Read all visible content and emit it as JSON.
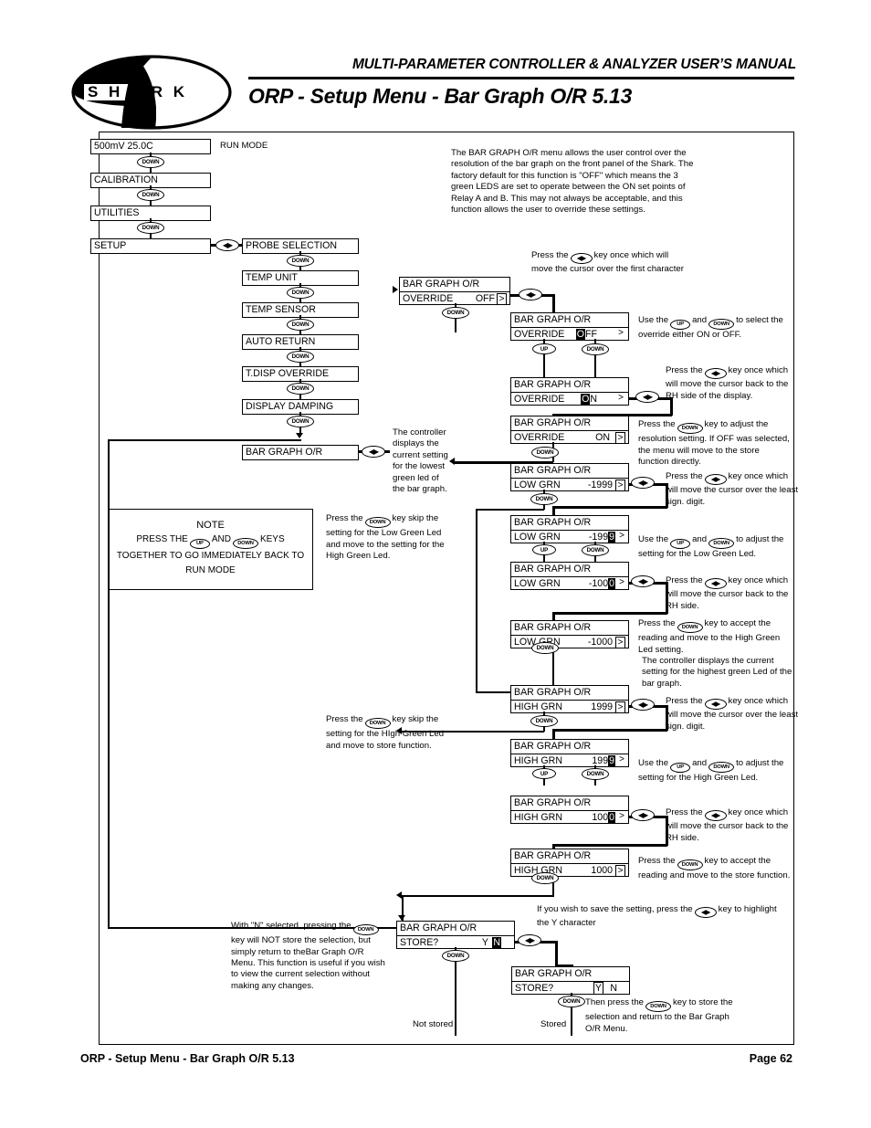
{
  "header": {
    "manual_title": "MULTI-PARAMETER CONTROLLER & ANALYZER USER’S MANUAL",
    "page_title": "ORP - Setup Menu - Bar Graph O/R 5.13",
    "logo_text": "S H A R K"
  },
  "footer": {
    "left": "ORP - Setup Menu - Bar Graph O/R 5.13",
    "right": "Page 62"
  },
  "keys": {
    "down": "DOWN",
    "up": "UP",
    "leftright": "◀▶"
  },
  "menu_chain": {
    "run_mode_label": "RUN MODE",
    "items": [
      {
        "text": "500mV  25.0C"
      },
      {
        "text": "CALIBRATION"
      },
      {
        "text": "UTILITIES"
      },
      {
        "text": "SETUP"
      }
    ]
  },
  "setup_chain": {
    "items": [
      {
        "text": "PROBE SELECTION"
      },
      {
        "text": "TEMP UNIT"
      },
      {
        "text": "TEMP SENSOR"
      },
      {
        "text": "AUTO RETURN"
      },
      {
        "text": "T.DISP OVERRIDE"
      },
      {
        "text": "DISPLAY DAMPING"
      },
      {
        "text": "BAR GRAPH O/R"
      }
    ]
  },
  "intro": {
    "text": "The BAR GRAPH O/R menu allows the user control over the resolution of the bar graph on the front panel of the Shark. The factory default for this function is \"OFF\" which means the 3  green LEDS are set to operate between the ON set points of Relay A and B.  This may not always be acceptable, and this function allows the user to override these settings."
  },
  "note": {
    "title": "NOTE",
    "line1_a": "PRESS THE",
    "line1_b": "AND",
    "line1_c": "KEYS",
    "line2": "TOGETHER TO GO IMMEDIATELY BACK TO",
    "line3": "RUN MODE"
  },
  "screens": {
    "override_off": {
      "title": "BAR GRAPH O/R",
      "label": "OVERRIDE",
      "value": "OFF",
      "marker": ">"
    },
    "override_off_cursor": {
      "title": "BAR GRAPH O/R",
      "label": "OVERRIDE",
      "cursor_char": "O",
      "rest": "FF",
      "marker": ">"
    },
    "override_on_cursor": {
      "title": "BAR GRAPH O/R",
      "label": "OVERRIDE",
      "cursor_char": "O",
      "rest": "N",
      "marker": ">"
    },
    "override_on": {
      "title": "BAR GRAPH O/R",
      "label": "OVERRIDE",
      "value": "ON",
      "marker": ">"
    },
    "low_grn_1999": {
      "title": "BAR GRAPH O/R",
      "label": "LOW GRN",
      "value": "-1999",
      "marker": ">"
    },
    "low_grn_cursor_9": {
      "title": "BAR GRAPH O/R",
      "label": "LOW GRN",
      "prefix": "-199",
      "cursor_char": "9",
      "marker": ">"
    },
    "low_grn_cursor_0": {
      "title": "BAR GRAPH O/R",
      "label": "LOW GRN",
      "prefix": "-100",
      "cursor_char": "0",
      "marker": ">"
    },
    "low_grn_1000": {
      "title": "BAR GRAPH O/R",
      "label": "LOW GRN",
      "value": "-1000",
      "marker": ">"
    },
    "high_grn_1999": {
      "title": "BAR GRAPH O/R",
      "label": "HIGH GRN",
      "value": "1999",
      "marker": ">"
    },
    "high_grn_cursor_9": {
      "title": "BAR GRAPH O/R",
      "label": "HIGH GRN",
      "prefix": "199",
      "cursor_char": "9",
      "marker": ">"
    },
    "high_grn_cursor_0": {
      "title": "BAR GRAPH O/R",
      "label": "HIGH GRN",
      "prefix": "100",
      "cursor_char": "0",
      "marker": ">"
    },
    "high_grn_1000": {
      "title": "BAR GRAPH O/R",
      "label": "HIGH GRN",
      "value": "1000",
      "marker": ">"
    },
    "store_n": {
      "title": "BAR GRAPH O/R",
      "label": "STORE?",
      "yes": "Y",
      "no": "N"
    },
    "store_y": {
      "title": "BAR GRAPH O/R",
      "label": "STORE?",
      "yes": "Y",
      "no": "N"
    }
  },
  "annotations": {
    "press_lr_first_char": "Press the          key once which will move the cursor over the first character",
    "use_up_down_override": "Use the        and           to select the override either ON or OFF.",
    "press_lr_back_rh_display": "Press the           key once which will move the cursor back to the RH side of the display.",
    "press_down_resolution": "Press the           key to adjust the resolution setting. If OFF was selected, the menu will move to the store function directly.",
    "controller_lowest_green": "The controller displays the current setting for the lowest green led of the bar graph.",
    "press_lr_least_sign_1": "Press the           key once which will move the cursor over the least sign. digit.",
    "use_up_down_low": "Use the        and           to adjust the setting for the Low Green Led.",
    "press_lr_back_rh_1": "Press the           key once which will move the cursor back to the RH side.",
    "press_down_accept_high": "Press the           key to accept the reading and move to the High Green Led setting.",
    "skip_low_green": "Press the           key skip the setting for the Low Green Led and move to the setting for the High Green Led.",
    "controller_highest_green": "The controller displays the current setting for the highest green Led of the bar graph.",
    "press_lr_least_sign_2": "Press the           key once which will move the cursor over the least sign. digit.",
    "use_up_down_high": "Use the        and           to adjust the setting for the High Green Led.",
    "press_lr_back_rh_2": "Press the           key once which will move the cursor back to the RH side.",
    "press_down_accept_store": "Press the           key to accept the reading and move to the store function.",
    "skip_high_green": "Press the           key skip the setting for the HIgh Green Led and move to store function.",
    "save_highlight_y": "If you wish to save the setting, press the           key to highlight the Y character",
    "with_n_selected": "With \"N\" selected, pressing the           key will NOT store the selection, but simply return to theBar Graph O/R Menu. This function is useful if you wish to view the current selection without making any changes.",
    "then_press_down_store": "Then press the           key to store the selection and return to the Bar Graph O/R Menu.",
    "not_stored": "Not stored",
    "stored": "Stored"
  }
}
